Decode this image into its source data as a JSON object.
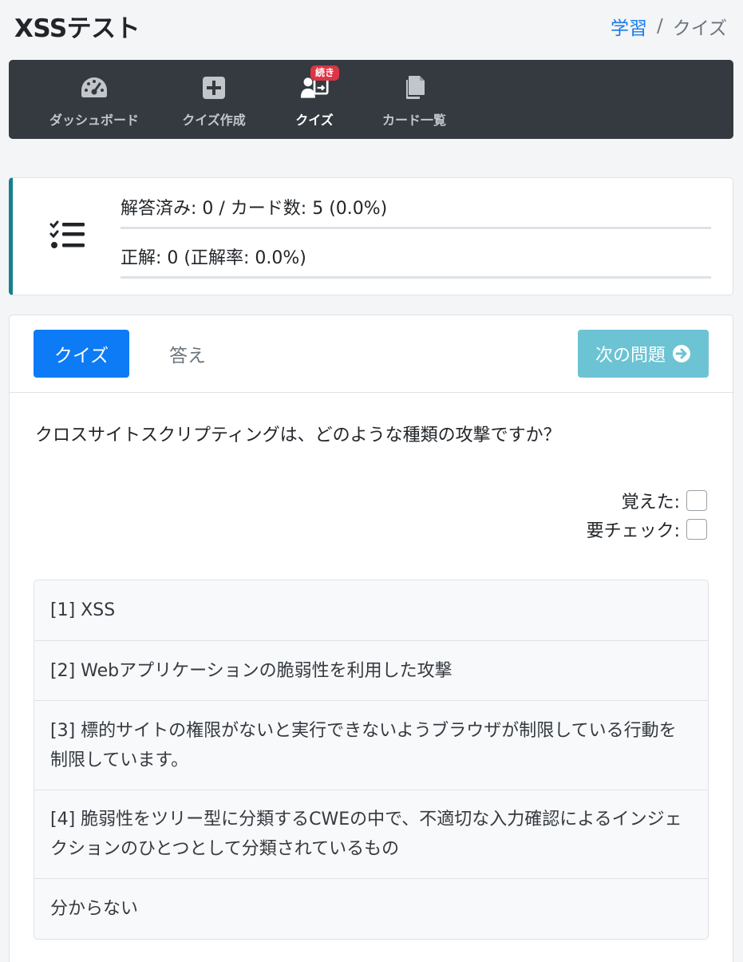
{
  "header": {
    "title": "XSSテスト",
    "breadcrumb": {
      "link": "学習",
      "separator": "/",
      "current": "クイズ"
    }
  },
  "nav": {
    "items": [
      {
        "label": "ダッシュボード",
        "icon": "gauge-icon"
      },
      {
        "label": "クイズ作成",
        "icon": "plus-square-icon"
      },
      {
        "label": "クイズ",
        "icon": "user-quiz-icon",
        "active": true
      },
      {
        "label": "カード一覧",
        "icon": "copy-icon"
      }
    ],
    "badge": "続き"
  },
  "stats": {
    "answered": "解答済み: 0 / カード数: 5 (0.0%)",
    "correct": "正解: 0 (正解率: 0.0%)"
  },
  "quiz": {
    "tab_quiz": "クイズ",
    "tab_answer": "答え",
    "next_label": "次の問題",
    "question": "クロスサイトスクリプティングは、どのような種類の攻撃ですか？",
    "memorized_label": "覚えた:",
    "needs_check_label": "要チェック:",
    "options": [
      " [1] XSS",
      " [2] Webアプリケーションの脆弱性を利用した攻撃",
      " [3] 標的サイトの権限がないと実行できないようブラウザが制限している行動を制限しています。",
      " [4] 脆弱性をツリー型に分類するCWEの中で、不適切な入力確認によるインジェクションのひとつとして分類されているもの",
      "分からない"
    ]
  },
  "colors": {
    "primary": "#0d7bf5",
    "info": "#6cc3d3",
    "navbar": "#343a40",
    "badge": "#dc3545",
    "stats_accent": "#17808c"
  }
}
